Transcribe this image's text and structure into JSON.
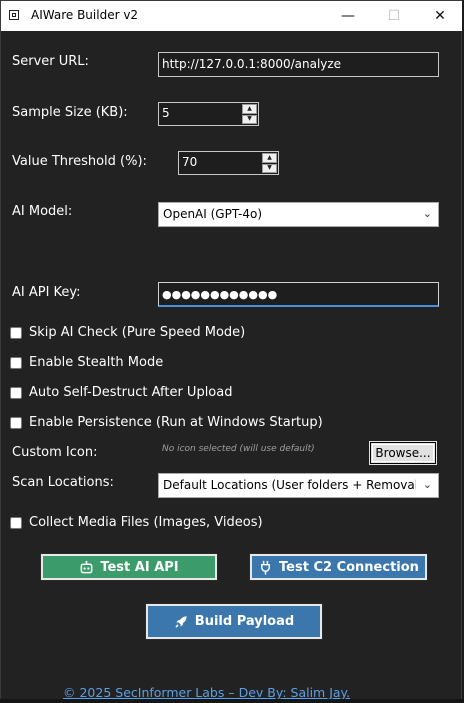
{
  "window": {
    "title": "AIWare Builder v2",
    "controls": {
      "minimize": "—",
      "maximize": "☐",
      "close": "✕"
    }
  },
  "form": {
    "server_url": {
      "label": "Server URL:",
      "value": "http://127.0.0.1:8000/analyze"
    },
    "sample_size": {
      "label": "Sample Size (KB):",
      "value": "5"
    },
    "value_threshold": {
      "label": "Value Threshold (%):",
      "value": "70"
    },
    "ai_model": {
      "label": "AI Model:",
      "selected": "OpenAI (GPT-4o)"
    },
    "ai_api_key": {
      "label": "AI API Key:",
      "masked_value": "●●●●●●●●●●●●"
    },
    "checkboxes": [
      {
        "label": "Skip AI Check (Pure Speed Mode)",
        "checked": false
      },
      {
        "label": "Enable Stealth Mode",
        "checked": false
      },
      {
        "label": "Auto Self-Destruct After Upload",
        "checked": false
      },
      {
        "label": "Enable Persistence (Run at Windows Startup)",
        "checked": false
      }
    ],
    "custom_icon": {
      "label": "Custom Icon:",
      "status": "No icon selected (will use default)",
      "browse_label": "Browse..."
    },
    "scan_locations": {
      "label": "Scan Locations:",
      "selected": "Default Locations (User folders + Removabl"
    },
    "collect_media": {
      "label": "Collect Media Files (Images, Videos)",
      "checked": false
    }
  },
  "actions": {
    "test_ai": "Test AI API",
    "test_c2": "Test C2 Connection",
    "build": "Build Payload"
  },
  "footer": {
    "credit": "© 2025 SecInformer Labs – Dev By: Salim Jay."
  },
  "colors": {
    "background": "#222222",
    "test_ai_button": "#3c9b6a",
    "test_c2_button": "#3b77ad",
    "build_button": "#3b77ad",
    "link": "#5aa0e6"
  },
  "icons": {
    "test_ai": "robot-icon",
    "test_c2": "plug-icon",
    "build": "rocket-icon"
  }
}
